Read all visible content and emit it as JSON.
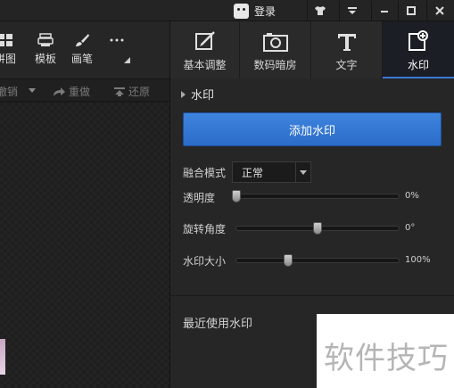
{
  "titlebar": {
    "login_label": "登录",
    "buttons": [
      "shirt-icon",
      "dropdown-icon",
      "minimize-icon",
      "maximize-icon",
      "close-icon"
    ]
  },
  "left_toolbar": {
    "items": [
      {
        "label": "拼图",
        "icon": "collage-icon"
      },
      {
        "label": "模板",
        "icon": "template-icon"
      },
      {
        "label": "画笔",
        "icon": "brush-icon"
      },
      {
        "label": "",
        "icon": "more-icon"
      }
    ],
    "undo_label": "撤销",
    "redo_label": "重做",
    "restore_label": "还原"
  },
  "tabs": [
    {
      "label": "基本调整",
      "icon": "adjust-icon"
    },
    {
      "label": "数码暗房",
      "icon": "darkroom-icon"
    },
    {
      "label": "文字",
      "icon": "text-icon"
    },
    {
      "label": "水印",
      "icon": "watermark-icon",
      "active": true
    }
  ],
  "panel": {
    "section_title": "水印",
    "add_button_label": "添加水印",
    "blend_mode_label": "融合模式",
    "blend_mode_value": "正常",
    "opacity": {
      "label": "透明度",
      "value_text": "0%",
      "fraction": 0.0
    },
    "rotation": {
      "label": "旋转角度",
      "value_text": "0°",
      "fraction": 0.5
    },
    "size": {
      "label": "水印大小",
      "value_text": "100%",
      "fraction": 0.32
    },
    "recent_label": "最近使用水印"
  },
  "overlay": {
    "watermark_text": "软件技巧"
  },
  "colors": {
    "accent": "#3a78d8",
    "button": "#2f71cf",
    "panel_bg": "#262626"
  }
}
